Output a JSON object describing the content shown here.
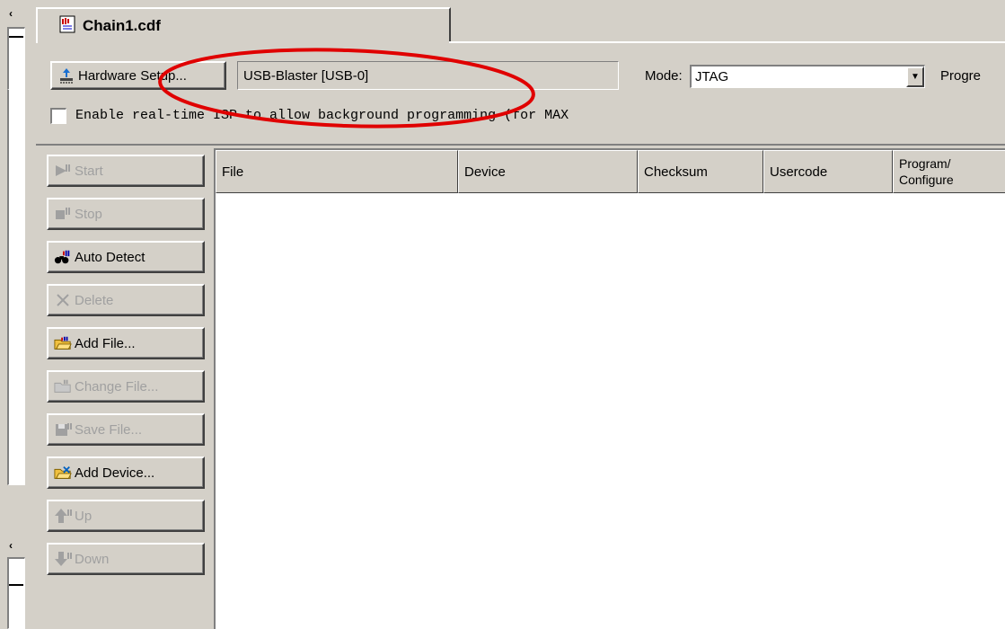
{
  "tab": {
    "title": "Chain1.cdf"
  },
  "hardware": {
    "setup_label": "Hardware Setup...",
    "device_value": "USB-Blaster [USB-0]"
  },
  "mode": {
    "label": "Mode:",
    "value": "JTAG",
    "progress_label": "Progre"
  },
  "isp": {
    "label": "Enable real-time ISP to allow background programming (for MAX"
  },
  "side_buttons": [
    {
      "label": "Start",
      "icon": "start-icon",
      "enabled": false
    },
    {
      "label": "Stop",
      "icon": "stop-icon",
      "enabled": false
    },
    {
      "label": "Auto Detect",
      "icon": "auto-detect-icon",
      "enabled": true
    },
    {
      "label": "Delete",
      "icon": "delete-icon",
      "enabled": false
    },
    {
      "label": "Add File...",
      "icon": "add-file-icon",
      "enabled": true
    },
    {
      "label": "Change File...",
      "icon": "change-file-icon",
      "enabled": false
    },
    {
      "label": "Save File...",
      "icon": "save-file-icon",
      "enabled": false
    },
    {
      "label": "Add Device...",
      "icon": "add-device-icon",
      "enabled": true
    },
    {
      "label": "Up",
      "icon": "up-icon",
      "enabled": false
    },
    {
      "label": "Down",
      "icon": "down-icon",
      "enabled": false
    }
  ],
  "table": {
    "columns": [
      "File",
      "Device",
      "Checksum",
      "Usercode",
      "Program/\nConfigure"
    ]
  },
  "annotation": {
    "color": "#e00000"
  }
}
